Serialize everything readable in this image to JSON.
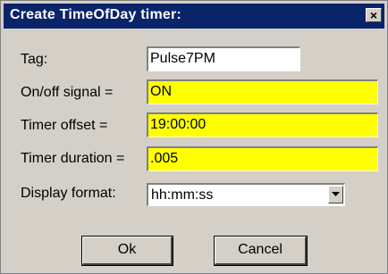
{
  "window": {
    "title": "Create TimeOfDay timer:",
    "close_glyph": "×"
  },
  "form": {
    "tag": {
      "label": "Tag:",
      "value": "Pulse7PM"
    },
    "signal": {
      "label": "On/off signal =",
      "value": "ON"
    },
    "offset": {
      "label": "Timer offset =",
      "value": "19:00:00"
    },
    "duration": {
      "label": "Timer duration =",
      "value": ".005"
    },
    "display_format": {
      "label": "Display format:",
      "value": "hh:mm:ss"
    }
  },
  "buttons": {
    "ok": "Ok",
    "cancel": "Cancel"
  },
  "colors": {
    "titlebar": "#0a246a",
    "highlight_field": "#ffff00",
    "white_field": "#ffffff",
    "dialog_bg": "#d4d0c8"
  }
}
